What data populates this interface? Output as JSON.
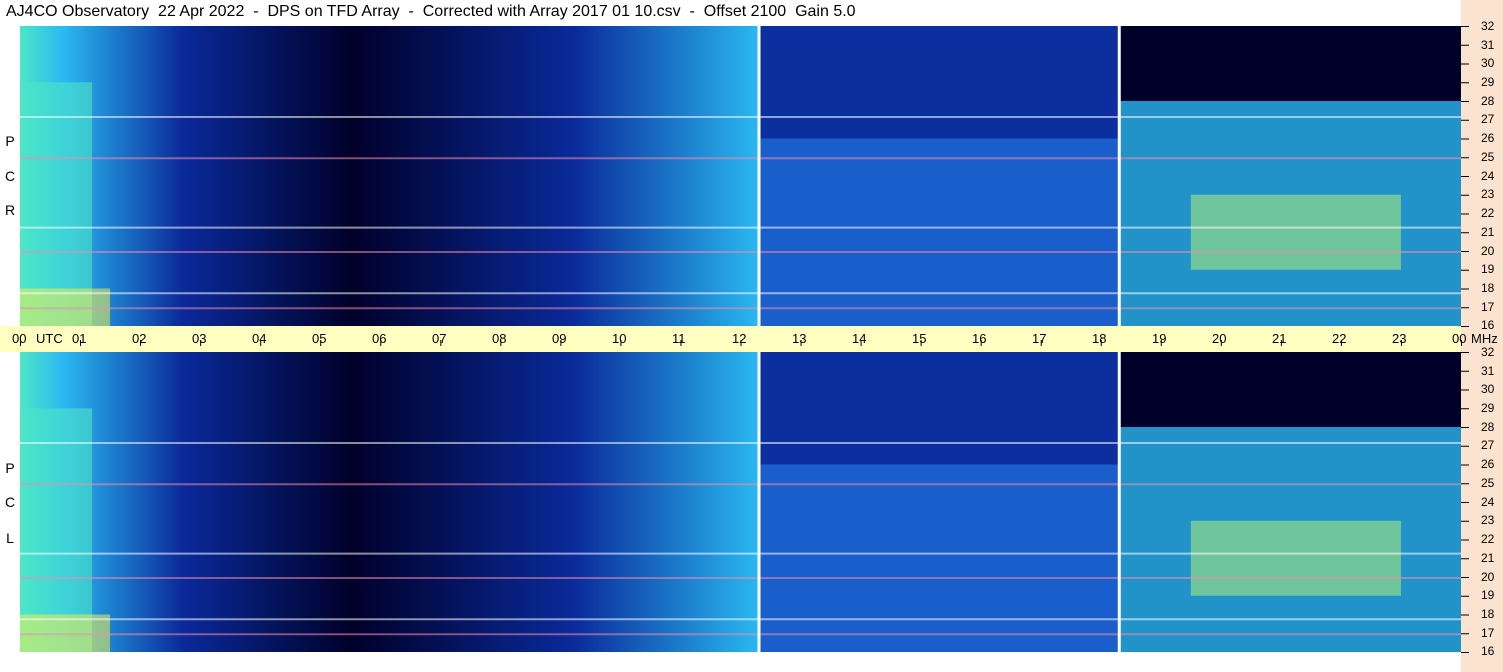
{
  "title": "AJ4CO Observatory  22 Apr 2022  -  DPS on TFD Array  -  Corrected with Array 2017 01 10.csv  -  Offset 2100  Gain 5.0",
  "chart_data": {
    "type": "heatmap",
    "title": "AJ4CO Observatory  22 Apr 2022  -  DPS on TFD Array  -  Corrected with Array 2017 01 10.csv  -  Offset 2100  Gain 5.0",
    "panels": [
      {
        "label_letters": [
          "R",
          "C",
          "P"
        ]
      },
      {
        "label_letters": [
          "L",
          "C",
          "P"
        ]
      }
    ],
    "x_axis": {
      "unit_label": "UTC",
      "ticks": [
        "00",
        "01",
        "02",
        "03",
        "04",
        "05",
        "06",
        "07",
        "08",
        "09",
        "10",
        "11",
        "12",
        "13",
        "14",
        "15",
        "16",
        "17",
        "18",
        "19",
        "20",
        "21",
        "22",
        "23",
        "00"
      ],
      "range": [
        0,
        24
      ]
    },
    "y_axis": {
      "unit_label": "MHz",
      "ticks": [
        32,
        31,
        30,
        29,
        28,
        27,
        26,
        25,
        24,
        23,
        22,
        21,
        20,
        19,
        18,
        17,
        16
      ],
      "range": [
        16,
        32
      ]
    },
    "colormap": [
      "#00002a",
      "#0a2a9a",
      "#1e6fe8",
      "#2ab8f0",
      "#4ce6c8",
      "#b0f078",
      "#f0f050",
      "#f08ab0",
      "#ffffff"
    ],
    "gaps_utc": [
      12.3,
      18.3
    ]
  }
}
